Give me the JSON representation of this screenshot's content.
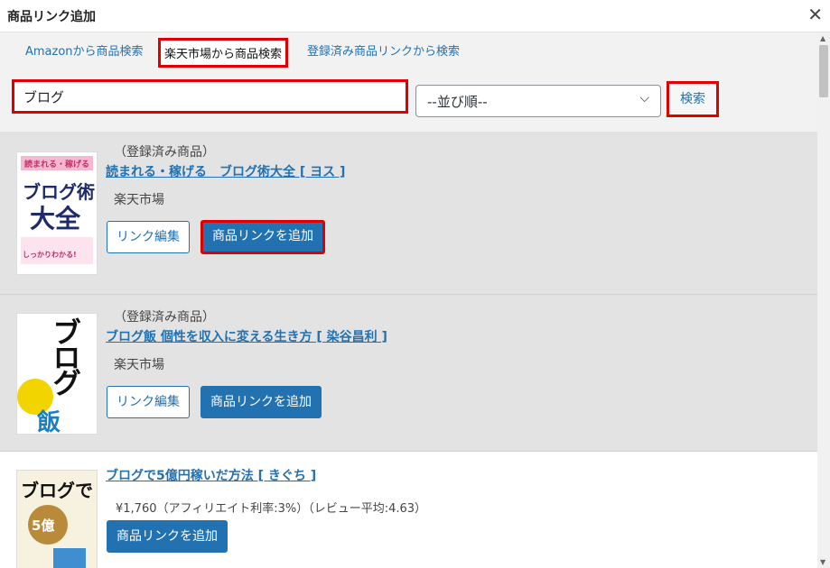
{
  "dialog": {
    "title": "商品リンク追加",
    "close_label": "✕"
  },
  "tabs": [
    {
      "label": "Amazonから商品検索"
    },
    {
      "label": "楽天市場から商品検索"
    },
    {
      "label": "登録済み商品リンクから検索"
    }
  ],
  "search": {
    "query": "ブログ",
    "sort_label": "--並び順--",
    "button_label": "検索"
  },
  "items": [
    {
      "note": "（登録済み商品）",
      "title": "読まれる・稼げる　ブログ術大全 [ ヨス ]",
      "shop": "楽天市場",
      "edit_label": "リンク編集",
      "add_label": "商品リンクを追加",
      "cover": {
        "line1": "読まれる・稼げる",
        "line2": "ブログ術",
        "line3": "大全",
        "line4": "しっかりわかる!"
      }
    },
    {
      "note": "（登録済み商品）",
      "title": "ブログ飯 個性を収入に変える生き方 [ 染谷昌利 ]",
      "shop": "楽天市場",
      "edit_label": "リンク編集",
      "add_label": "商品リンクを追加",
      "cover": {
        "line1": "ブログ",
        "line2": "飯"
      }
    },
    {
      "title": "ブログで5億円稼いだ方法 [ きぐち ]",
      "price": "¥1,760（アフィリエイト利率:3%）（レビュー平均:4.63）",
      "add_label": "商品リンクを追加",
      "cover": {
        "line1": "ブログで",
        "line2": "5億"
      }
    }
  ],
  "colors": {
    "accent": "#2271b1",
    "highlight": "#e00000",
    "registered_bg": "#e3e3e3"
  }
}
